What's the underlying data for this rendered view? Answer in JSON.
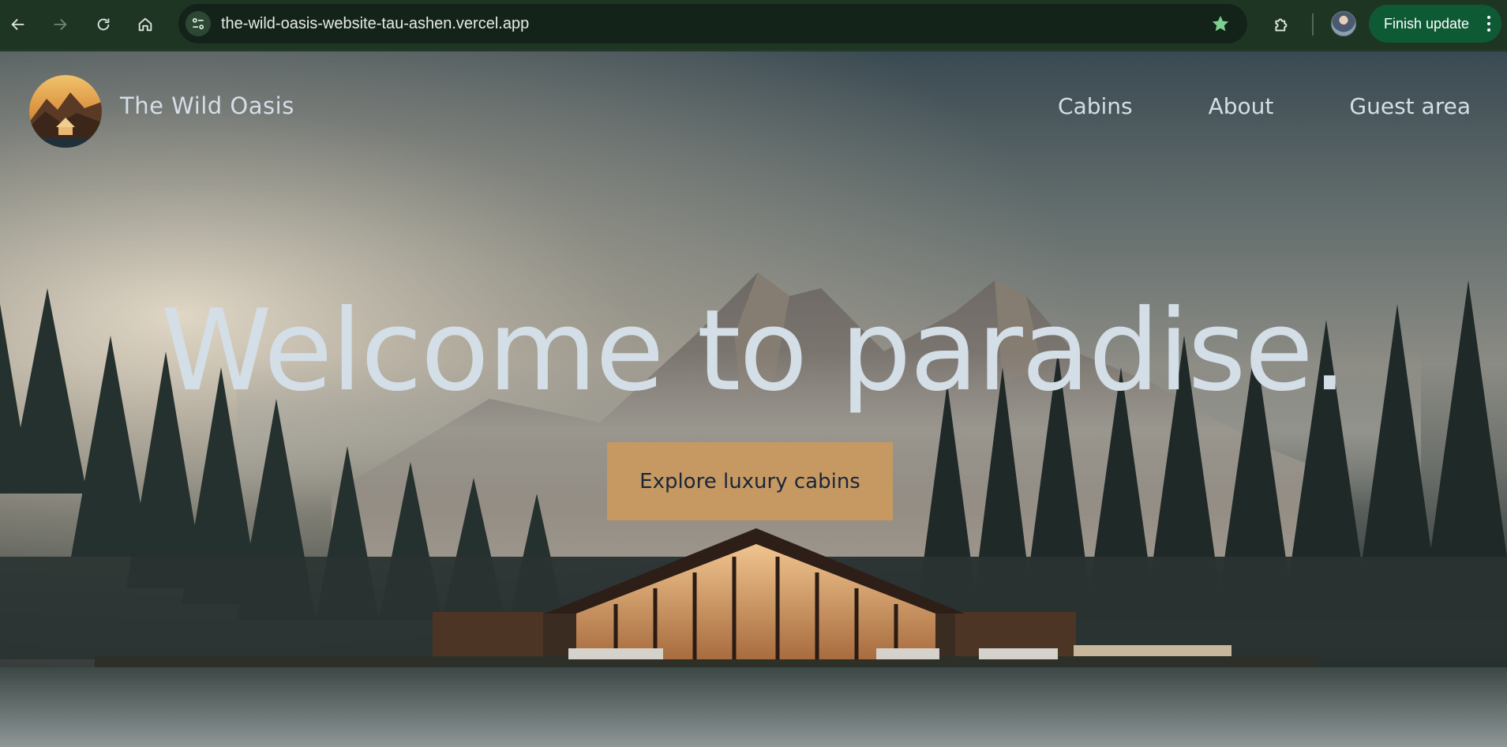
{
  "browser": {
    "url": "the-wild-oasis-website-tau-ashen.vercel.app",
    "finish_update_label": "Finish update",
    "icons": {
      "back": "arrow-left-icon",
      "forward": "arrow-right-icon",
      "reload": "reload-icon",
      "home": "home-icon",
      "site_info": "tune-icon",
      "bookmark": "star-icon",
      "extensions": "puzzle-icon",
      "menu": "kebab-icon"
    },
    "colors": {
      "bookmark_star": "#7ed08f",
      "update_button": "#0e5a35"
    }
  },
  "site": {
    "title": "The Wild Oasis",
    "nav": [
      "Cabins",
      "About",
      "Guest area"
    ]
  },
  "hero": {
    "heading": "Welcome to paradise.",
    "cta_label": "Explore luxury cabins",
    "colors": {
      "cta_bg": "#c69963",
      "cta_text": "#1b2638",
      "heading": "#d4dee7"
    }
  }
}
